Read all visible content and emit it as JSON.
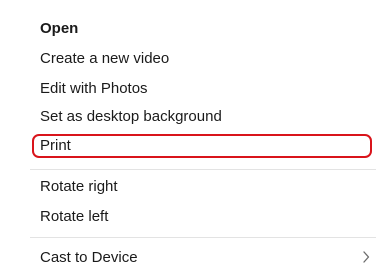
{
  "menu": {
    "items": [
      {
        "label": "Open"
      },
      {
        "label": "Create a new video"
      },
      {
        "label": "Edit with Photos"
      },
      {
        "label": "Set as desktop background"
      },
      {
        "label": "Print"
      },
      {
        "label": "Rotate right"
      },
      {
        "label": "Rotate left"
      },
      {
        "label": "Cast to Device"
      }
    ],
    "highlight_color": "#d9141b",
    "submenu_icon": "chevron-right-icon"
  }
}
